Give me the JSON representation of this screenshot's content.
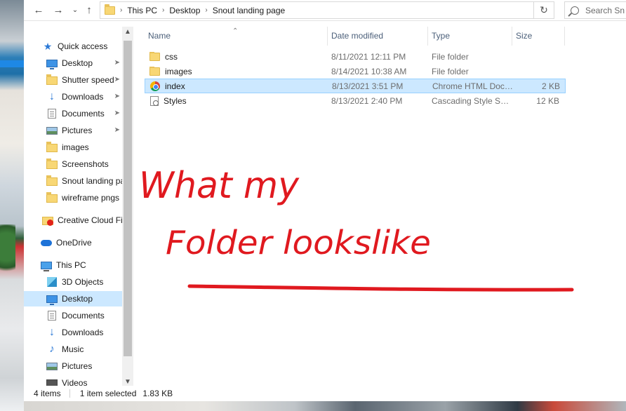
{
  "address": {
    "crumbs": [
      "This PC",
      "Desktop",
      "Snout landing page"
    ]
  },
  "search": {
    "placeholder": "Search Sn"
  },
  "nav": {
    "items": [
      {
        "label": "Quick access",
        "icon": "star-icon",
        "pinned": false
      },
      {
        "label": "Desktop",
        "icon": "desktop-icon",
        "pinned": true
      },
      {
        "label": "Shutter speed",
        "icon": "folder-icon",
        "pinned": true
      },
      {
        "label": "Downloads",
        "icon": "download-icon",
        "pinned": true
      },
      {
        "label": "Documents",
        "icon": "document-icon",
        "pinned": true
      },
      {
        "label": "Pictures",
        "icon": "pictures-icon",
        "pinned": true
      },
      {
        "label": "images",
        "icon": "folder-icon",
        "pinned": false
      },
      {
        "label": "Screenshots",
        "icon": "folder-icon",
        "pinned": false
      },
      {
        "label": "Snout landing page",
        "icon": "folder-icon",
        "pinned": false
      },
      {
        "label": "wireframe pngs",
        "icon": "folder-icon",
        "pinned": false
      },
      {
        "label": "Creative Cloud Files",
        "icon": "creative-cloud-icon",
        "pinned": false
      },
      {
        "label": "OneDrive",
        "icon": "onedrive-icon",
        "pinned": false
      },
      {
        "label": "This PC",
        "icon": "this-pc-icon",
        "pinned": false
      },
      {
        "label": "3D Objects",
        "icon": "3d-objects-icon",
        "pinned": false
      },
      {
        "label": "Desktop",
        "icon": "desktop-icon",
        "pinned": false,
        "selected": true
      },
      {
        "label": "Documents",
        "icon": "document-icon",
        "pinned": false
      },
      {
        "label": "Downloads",
        "icon": "download-icon",
        "pinned": false
      },
      {
        "label": "Music",
        "icon": "music-icon",
        "pinned": false
      },
      {
        "label": "Pictures",
        "icon": "pictures-icon",
        "pinned": false
      },
      {
        "label": "Videos",
        "icon": "videos-icon",
        "pinned": false
      }
    ]
  },
  "columns": {
    "name": "Name",
    "date": "Date modified",
    "type": "Type",
    "size": "Size"
  },
  "files": [
    {
      "name": "css",
      "date": "8/11/2021 12:11 PM",
      "type": "File folder",
      "size": "",
      "icon": "folder-icon"
    },
    {
      "name": "images",
      "date": "8/14/2021 10:38 AM",
      "type": "File folder",
      "size": "",
      "icon": "folder-icon"
    },
    {
      "name": "index",
      "date": "8/13/2021 3:51 PM",
      "type": "Chrome HTML Document",
      "size": "2 KB",
      "icon": "chrome-icon",
      "selected": true
    },
    {
      "name": "Styles",
      "date": "8/13/2021 2:40 PM",
      "type": "Cascading Style Sheet Document",
      "size": "12 KB",
      "icon": "css-file-icon"
    }
  ],
  "status": {
    "count": "4 items",
    "selection": "1 item selected",
    "size": "1.83 KB"
  },
  "annotation": {
    "line1": "What my",
    "line2": "Folder lookslike"
  },
  "colors": {
    "ink": "#e0191f",
    "selection": "#cce8ff",
    "accent": "#2b79d6"
  }
}
